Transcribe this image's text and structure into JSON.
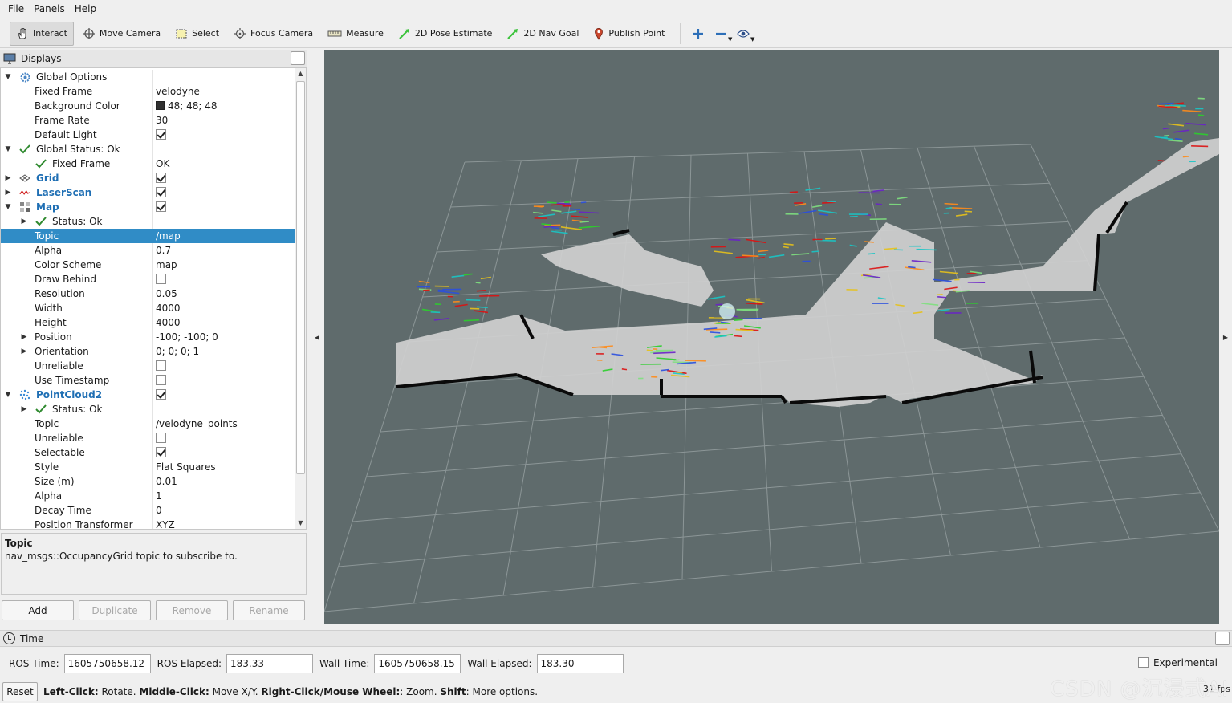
{
  "menu": [
    "File",
    "Panels",
    "Help"
  ],
  "toolbar": {
    "interact": "Interact",
    "move_camera": "Move Camera",
    "select": "Select",
    "focus_camera": "Focus Camera",
    "measure": "Measure",
    "pose_estimate": "2D Pose Estimate",
    "nav_goal": "2D Nav Goal",
    "publish_point": "Publish Point",
    "icons": [
      "plus-icon",
      "minus-icon",
      "eye-icon"
    ]
  },
  "displays": {
    "title": "Displays",
    "rows": [
      {
        "label": "Global Options",
        "value": ""
      },
      {
        "label": "Fixed Frame",
        "value": "velodyne"
      },
      {
        "label": "Background Color",
        "value": "48; 48; 48"
      },
      {
        "label": "Frame Rate",
        "value": "30"
      },
      {
        "label": "Default Light",
        "value": ""
      },
      {
        "label": "Global Status: Ok",
        "value": ""
      },
      {
        "label": "Fixed Frame",
        "value": "OK"
      },
      {
        "label": "Grid",
        "value": ""
      },
      {
        "label": "LaserScan",
        "value": ""
      },
      {
        "label": "Map",
        "value": ""
      },
      {
        "label": "Status: Ok",
        "value": ""
      },
      {
        "label": "Topic",
        "value": "/map"
      },
      {
        "label": "Alpha",
        "value": "0.7"
      },
      {
        "label": "Color Scheme",
        "value": "map"
      },
      {
        "label": "Draw Behind",
        "value": ""
      },
      {
        "label": "Resolution",
        "value": "0.05"
      },
      {
        "label": "Width",
        "value": "4000"
      },
      {
        "label": "Height",
        "value": "4000"
      },
      {
        "label": "Position",
        "value": "-100; -100; 0"
      },
      {
        "label": "Orientation",
        "value": "0; 0; 0; 1"
      },
      {
        "label": "Unreliable",
        "value": ""
      },
      {
        "label": "Use Timestamp",
        "value": ""
      },
      {
        "label": "PointCloud2",
        "value": ""
      },
      {
        "label": "Status: Ok",
        "value": ""
      },
      {
        "label": "Topic",
        "value": "/velodyne_points"
      },
      {
        "label": "Unreliable",
        "value": ""
      },
      {
        "label": "Selectable",
        "value": ""
      },
      {
        "label": "Style",
        "value": "Flat Squares"
      },
      {
        "label": "Size (m)",
        "value": "0.01"
      },
      {
        "label": "Alpha",
        "value": "1"
      },
      {
        "label": "Decay Time",
        "value": "0"
      },
      {
        "label": "Position Transformer",
        "value": "XYZ"
      }
    ],
    "checked": {
      "default_light": true,
      "grid": true,
      "laserscan": true,
      "map": true,
      "draw_behind": false,
      "map_unreliable": false,
      "use_timestamp": false,
      "pointcloud2": true,
      "pc_unreliable": false,
      "selectable": true
    }
  },
  "description": {
    "title": "Topic",
    "text": "nav_msgs::OccupancyGrid topic to subscribe to."
  },
  "panel_buttons": {
    "add": "Add",
    "duplicate": "Duplicate",
    "remove": "Remove",
    "rename": "Rename"
  },
  "time": {
    "title": "Time",
    "ros_time_label": "ROS Time:",
    "ros_time": "1605750658.12",
    "ros_elapsed_label": "ROS Elapsed:",
    "ros_elapsed": "183.33",
    "wall_time_label": "Wall Time:",
    "wall_time": "1605750658.15",
    "wall_elapsed_label": "Wall Elapsed:",
    "wall_elapsed": "183.30",
    "experimental": "Experimental"
  },
  "status": {
    "reset": "Reset",
    "hint_parts": [
      "Left-Click:",
      " Rotate. ",
      "Middle-Click:",
      " Move X/Y. ",
      "Right-Click/Mouse Wheel:",
      ": Zoom. ",
      "Shift",
      ": More options."
    ],
    "fps": "31 fps",
    "watermark": "CSDN @沉浸式AI"
  },
  "colors": {
    "viewport_bg": "#5f6b6c",
    "selection": "#308cc6",
    "map_free": "#d0d0d0",
    "map_wall": "#0a0a0a"
  }
}
